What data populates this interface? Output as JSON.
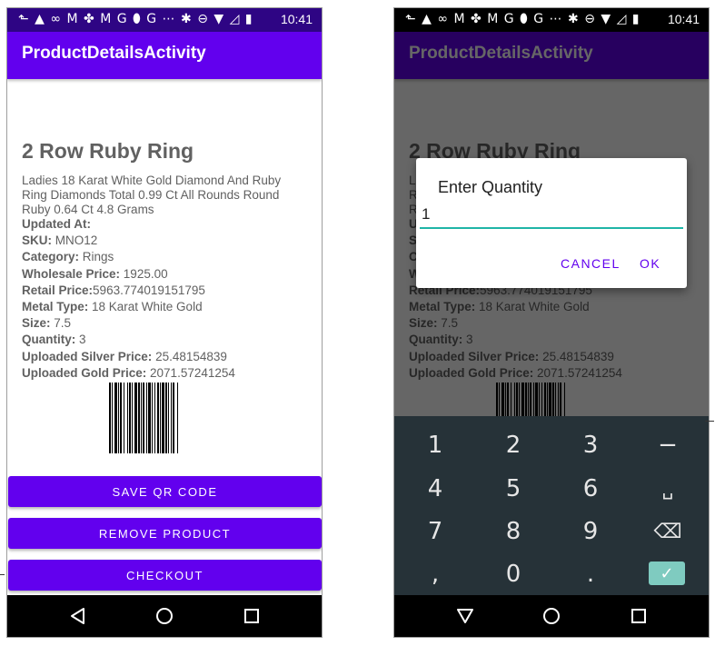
{
  "status_bar": {
    "icons": "⬑ ▲ ∞ M ✤ M G ⬮ G ⋯ ✱ ⊖ ▼ ◿ ▮",
    "time": "10:41"
  },
  "app_bar": {
    "title": "ProductDetailsActivity"
  },
  "product": {
    "title": "2 Row Ruby Ring",
    "description": "Ladies 18 Karat White Gold Diamond And Ruby Ring Diamonds Total 0.99   Ct All Rounds Round Ruby 0.64 Ct 4.8 Grams",
    "fields": [
      {
        "label": "Updated At:",
        "value": ""
      },
      {
        "label": "SKU:",
        "value": " MNO12"
      },
      {
        "label": "Category:",
        "value": " Rings"
      },
      {
        "label": "Wholesale Price:",
        "value": " 1925.00"
      },
      {
        "label": "Retail Price:",
        "value": "5963.774019151795"
      },
      {
        "label": "Metal Type:",
        "value": " 18 Karat White Gold"
      },
      {
        "label": "Size:",
        "value": " 7.5"
      },
      {
        "label": "Quantity:",
        "value": " 3"
      },
      {
        "label": "Uploaded Silver Price:",
        "value": " 25.48154839"
      },
      {
        "label": "Uploaded Gold Price:",
        "value": " 2071.57241254"
      }
    ]
  },
  "buttons": {
    "save_qr": "SAVE QR CODE",
    "remove_product": "REMOVE PRODUCT",
    "checkout": "CHECKOUT"
  },
  "dialog": {
    "title": "Enter Quantity",
    "input_value": "1",
    "cancel": "CANCEL",
    "ok": "OK"
  },
  "keyboard": {
    "keys": [
      "1",
      "2",
      "3",
      "−",
      "4",
      "5",
      "6",
      "␣",
      "7",
      "8",
      "9",
      "⌫",
      ",",
      "0",
      ".",
      "✓"
    ]
  },
  "colors": {
    "primary": "#6200ee",
    "primary_dark": "#2e0584",
    "accent": "#1fb5a7",
    "keyboard_bg": "#263238"
  },
  "icons": {
    "nav_back": "back-triangle-icon",
    "nav_home": "home-circle-icon",
    "nav_recent": "recents-square-icon"
  }
}
